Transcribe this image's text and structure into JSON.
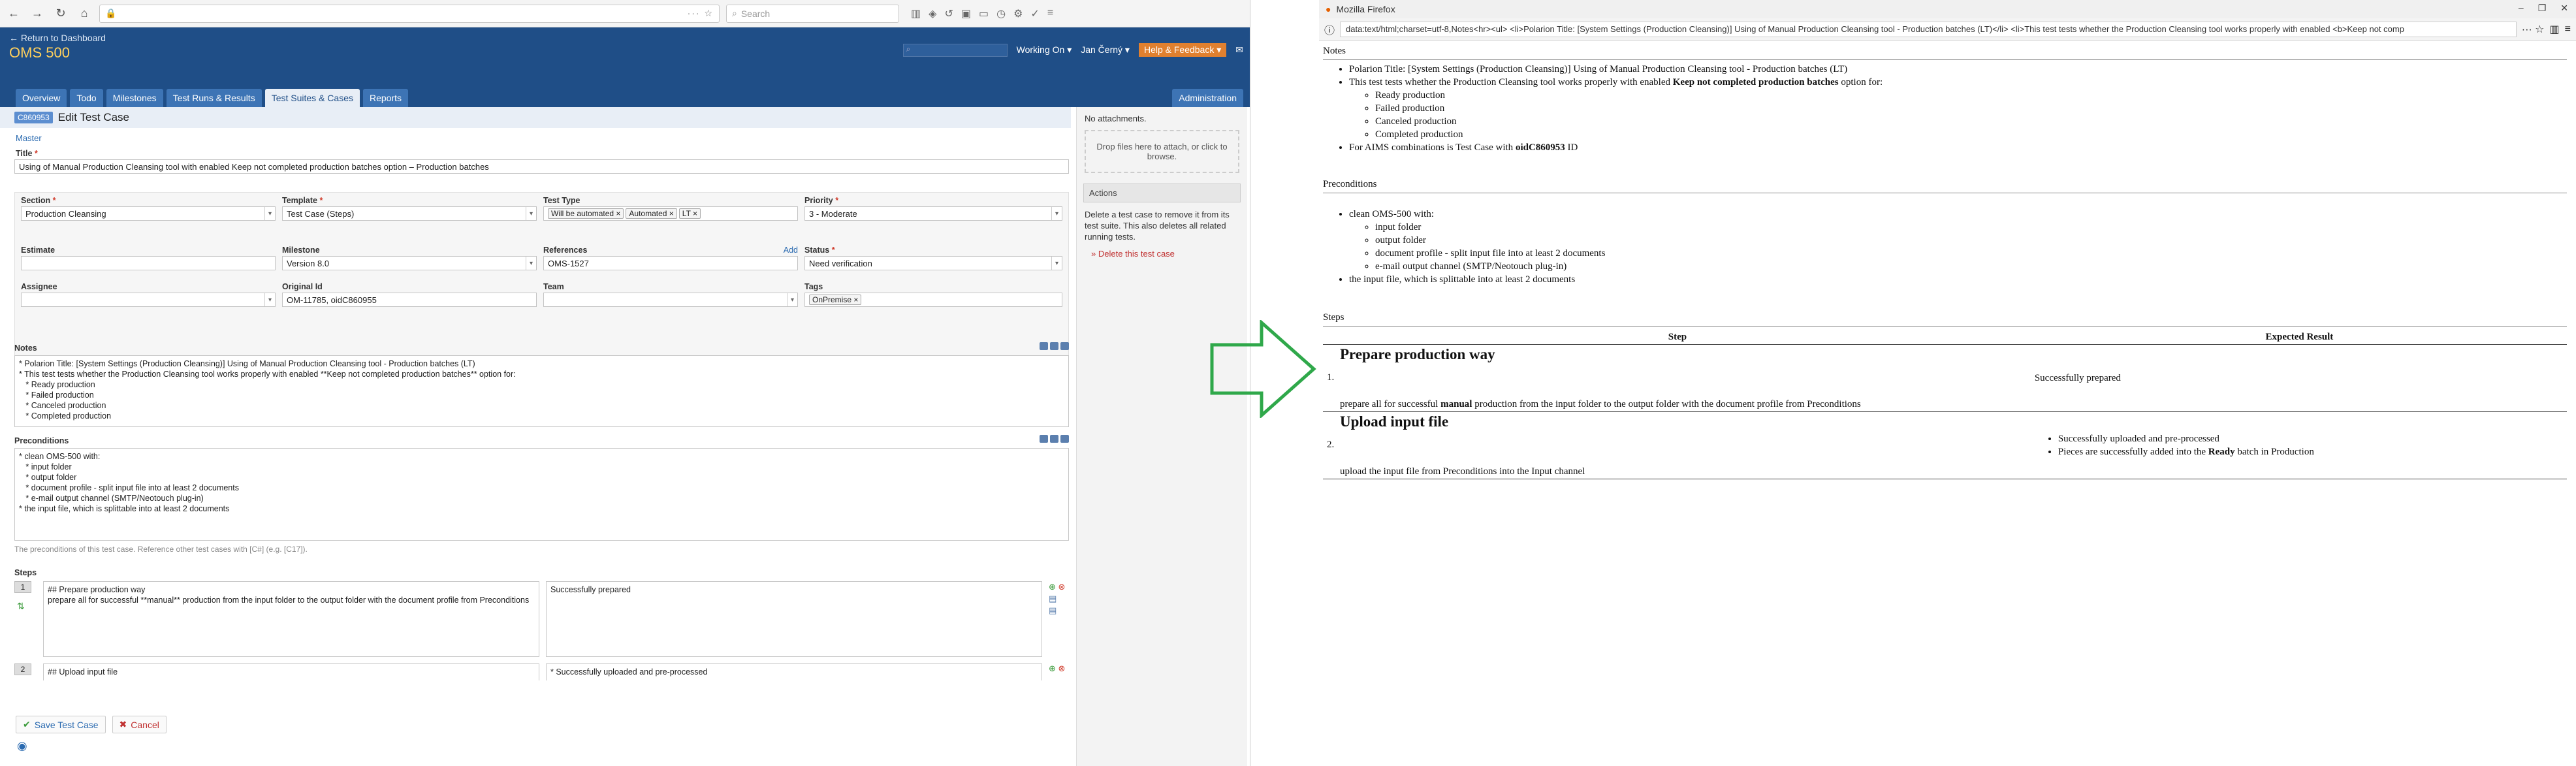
{
  "browser": {
    "url_secure": "🔒",
    "search_placeholder": "Search"
  },
  "app": {
    "return_link": "← Return to Dashboard",
    "project": "OMS 500",
    "working_on": "Working On ▾",
    "user": "Jan Černý ▾",
    "help": "Help & Feedback ▾",
    "tabs": [
      "Overview",
      "Todo",
      "Milestones",
      "Test Runs & Results",
      "Test Suites & Cases",
      "Reports"
    ],
    "admin_tab": "Administration"
  },
  "testcase": {
    "case_id": "C860953",
    "heading": "Edit Test Case",
    "master": "Master",
    "title_label": "Title",
    "title_value": "Using of Manual Production Cleansing tool with enabled Keep not completed production batches option – Production batches",
    "section_label": "Section",
    "section_value": "Production Cleansing",
    "template_label": "Template",
    "template_value": "Test Case (Steps)",
    "type_label": "Test Type",
    "type_tags": [
      "Will be automated",
      "Automated",
      "LT"
    ],
    "priority_label": "Priority",
    "priority_value": "3 - Moderate",
    "estimate_label": "Estimate",
    "estimate_value": "",
    "milestone_label": "Milestone",
    "milestone_value": "Version 8.0",
    "references_label": "References",
    "references_add": "Add",
    "references_value": "OMS-1527",
    "status_label": "Status",
    "status_value": "Need verification",
    "assignee_label": "Assignee",
    "original_label": "Original Id",
    "original_value": "OM-11785, oidC860955",
    "team_label": "Team",
    "tags_label": "Tags",
    "tags_values": [
      "OnPremise"
    ],
    "notes_label": "Notes",
    "notes_text": "* Polarion Title: [System Settings (Production Cleansing)] Using of Manual Production Cleansing tool - Production batches (LT)\n* This test tests whether the Production Cleansing tool works properly with enabled **Keep not completed production batches** option for:\n   * Ready production\n   * Failed production\n   * Canceled production\n   * Completed production",
    "preconditions_label": "Preconditions",
    "preconditions_text": "* clean OMS-500 with:\n   * input folder\n   * output folder\n   * document profile - split input file into at least 2 documents\n   * e-mail output channel (SMTP/Neotouch plug-in)\n* the input file, which is splittable into at least 2 documents",
    "preconditions_hint": "The preconditions of this test case. Reference other test cases with [C#] (e.g. [C17]).",
    "steps_label": "Steps",
    "steps": [
      {
        "num": "1",
        "content": "## Prepare production way\nprepare all for successful **manual** production from the input folder to the output folder with the document profile from Preconditions",
        "expected": "Successfully prepared"
      },
      {
        "num": "2",
        "content": "## Upload input file",
        "expected": "* Successfully uploaded and pre-processed"
      }
    ],
    "save_label": "Save Test Case",
    "cancel_label": "Cancel"
  },
  "sidebar": {
    "attachments": "No attachments.",
    "drop_hint": "Drop files here to attach, or click to browse.",
    "actions_title": "Actions",
    "actions_desc": "Delete a test case to remove it from its test suite. This also deletes all related running tests.",
    "delete_link": "» Delete this test case"
  },
  "firefox": {
    "window_title": "Mozilla Firefox",
    "url": "data:text/html;charset=utf-8,Notes<hr><ul> <li>Polarion Title: [System Settings (Production Cleansing)] Using of Manual Production Cleansing tool - Production batches (LT)</li> <li>This test tests whether the Production Cleansing tool works properly with enabled <b>Keep not comp",
    "notes_heading": "Notes",
    "notes_items": {
      "i1": "Polarion Title: [System Settings (Production Cleansing)] Using of Manual Production Cleansing tool - Production batches (LT)",
      "i2_pre": "This test tests whether the Production Cleansing tool works properly with enabled ",
      "i2_bold": "Keep not completed production batches",
      "i2_post": " option for:",
      "sub": [
        "Ready production",
        "Failed production",
        "Canceled production",
        "Completed production"
      ],
      "i3_pre": "For AIMS combinations is Test Case with ",
      "i3_bold": "oidC860953",
      "i3_post": " ID"
    },
    "pre_heading": "Preconditions",
    "pre_items": {
      "i1": "clean OMS-500 with:",
      "sub": [
        "input folder",
        "output folder",
        "document profile - split input file into at least 2 documents",
        "e-mail output channel (SMTP/Neotouch plug-in)"
      ],
      "i2": "the input file, which is splittable into at least 2 documents"
    },
    "steps_heading": "Steps",
    "col_step": "Step",
    "col_expected": "Expected Result",
    "steps": [
      {
        "num": "1.",
        "title": "Prepare production way",
        "text_pre": "prepare all for successful ",
        "text_bold": "manual",
        "text_post": " production from the input folder to the output folder with the document profile from Preconditions",
        "expected": "Successfully prepared"
      },
      {
        "num": "2.",
        "title": "Upload input file",
        "text": "upload the input file from Preconditions into the Input channel",
        "expected_list": [
          "Successfully uploaded and pre-processed"
        ],
        "expected2_pre": "Pieces are successfully added into the ",
        "expected2_bold": "Ready",
        "expected2_post": " batch in Production"
      }
    ]
  },
  "colors": {
    "header": "#1f4e87",
    "accent": "#ffd05c",
    "arrow": "#2fa84a"
  }
}
